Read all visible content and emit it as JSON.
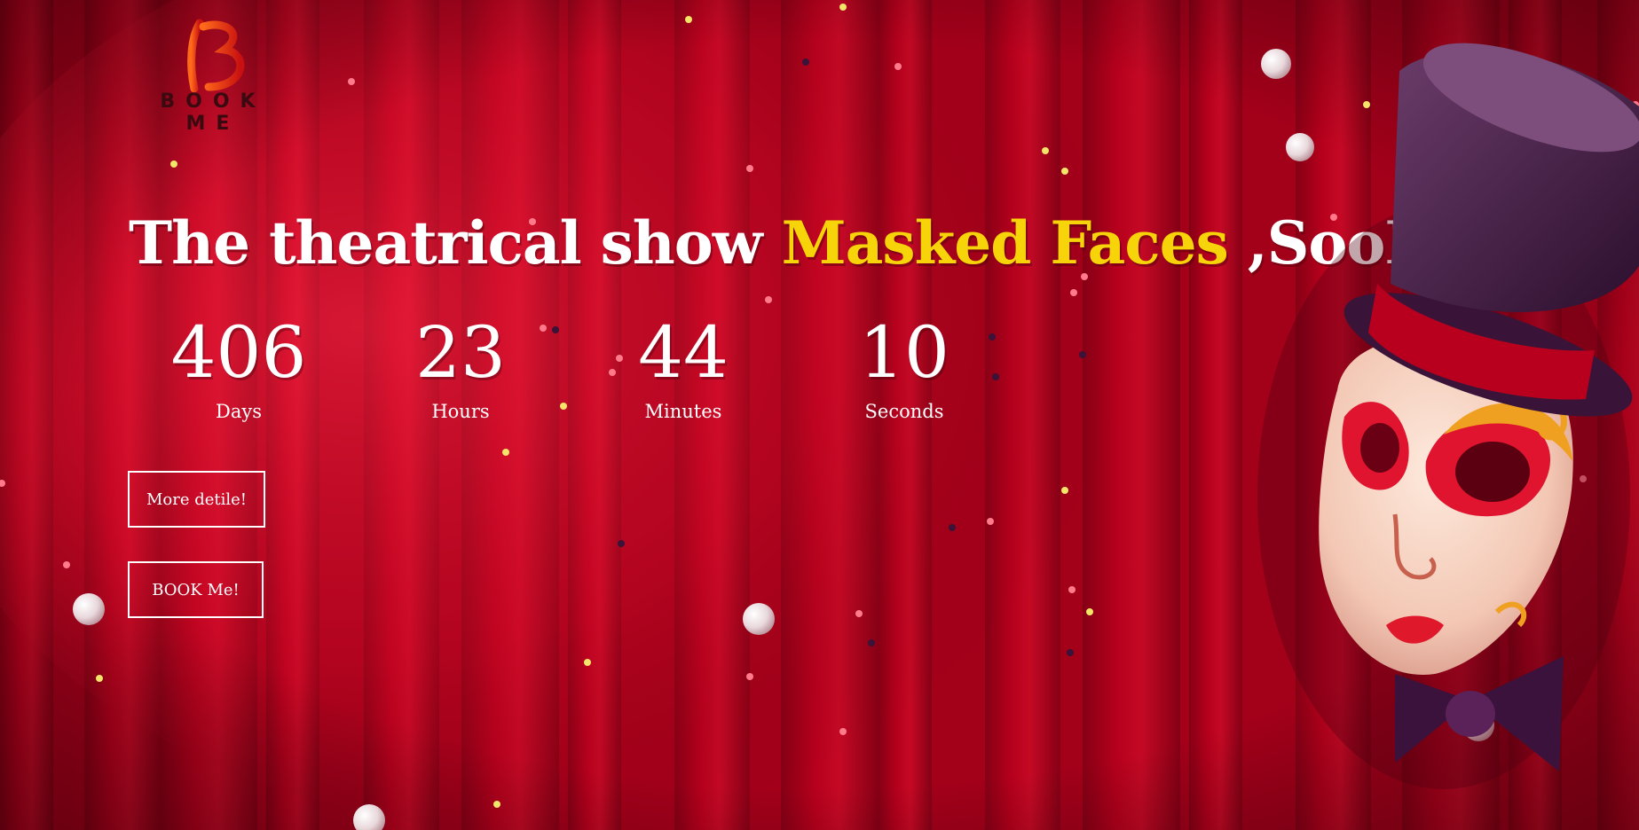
{
  "brand": {
    "logo_text": "BOOK ME"
  },
  "headline": {
    "before": "The theatrical show ",
    "highlight": "Masked Faces",
    "after": " ,SooN"
  },
  "countdown": [
    {
      "value": "406",
      "label": "Days"
    },
    {
      "value": "23",
      "label": "Hours"
    },
    {
      "value": "44",
      "label": "Minutes"
    },
    {
      "value": "10",
      "label": "Seconds"
    }
  ],
  "buttons": {
    "more_label": "More detile!",
    "book_label": "BOOK Me!"
  },
  "colors": {
    "curtain": "#c8001f",
    "curtain_dark": "#7a0012",
    "accent_yellow": "#f7d40a",
    "text": "#ffffff"
  },
  "decor": {
    "illustration": "masked-clown-with-top-hat",
    "particles": "confetti-and-pearls"
  }
}
